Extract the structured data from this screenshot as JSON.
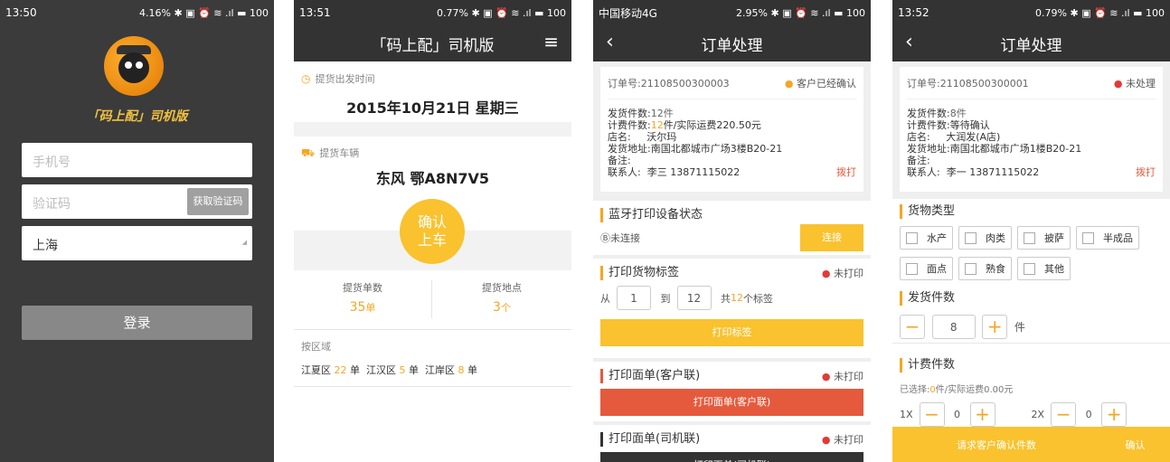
{
  "screen1": {
    "status_time": "13:50",
    "status_right": "4.16% ✱ ▣ ⏰ ≋ .ıl ▬ 100",
    "brand": "「码上配」司机版",
    "phone_placeholder": "手机号",
    "code_placeholder": "验证码",
    "get_code_label": "获取验证码",
    "city_value": "上海",
    "login_label": "登录"
  },
  "screen2": {
    "status_time": "13:51",
    "status_right": "0.77% ✱ ▣ ⏰ ≋ .ıl ▬ 100",
    "title": "「码上配」司机版",
    "pickup_time_label": "提货出发时间",
    "pickup_date": "2015年10月21日 星期三",
    "vehicle_label": "提货车辆",
    "vehicle_name": "东风 鄂A8N7V5",
    "confirm_line1": "确认",
    "confirm_line2": "上车",
    "order_count_label": "提货单数",
    "order_count_value": "35",
    "order_count_unit": "单",
    "location_label": "提货地点",
    "location_value": "3",
    "location_unit": "个",
    "by_area_label": "按区域",
    "areas": [
      {
        "name": "江夏区",
        "count": "22",
        "unit": "单"
      },
      {
        "name": "江汉区",
        "count": "5",
        "unit": "单"
      },
      {
        "name": "江岸区",
        "count": "8",
        "unit": "单"
      }
    ]
  },
  "screen3": {
    "status_carrier": "中国移动4G",
    "status_right": "2.95% ✱ ▣ ⏰ ≋ .ıl ▬ 100",
    "title": "订单处理",
    "order_no": "订单号:21108500300003",
    "order_status": "客户已经确认",
    "ship_count_label": "发货件数:",
    "ship_count_value": "12件",
    "charge_label": "计费件数:",
    "charge_value_highlight": "12",
    "charge_value_rest": "件/实际运费220.50元",
    "store_label": "店名:",
    "store_value": "沃尔玛",
    "address_label": "发货地址:",
    "address_value": "南国北都城市广场3楼B20-21",
    "remark_label": "备注:",
    "contact_label": "联系人:",
    "contact_value": "李三 13871115022",
    "dial_label": "拨打",
    "bt_title": "蓝牙打印设备状态",
    "bt_status": "未连接",
    "connect_label": "连接",
    "label_title": "打印货物标签",
    "not_printed": "未打印",
    "from_label": "从",
    "from_value": "1",
    "to_label": "到",
    "to_value": "12",
    "total_prefix": "共",
    "total_value": "12",
    "total_suffix": "个标签",
    "print_label_btn": "打印标签",
    "customer_title": "打印面单(客户联)",
    "print_customer_btn": "打印面单(客户联)",
    "driver_title": "打印面单(司机联)",
    "print_driver_btn": "打印面单(司机联)"
  },
  "screen4": {
    "status_time": "13:52",
    "status_right": "0.79% ✱ ▣ ⏰ ≋ .ıl ▬ 100",
    "title": "订单处理",
    "order_no": "订单号:21108500300001",
    "order_status": "未处理",
    "ship_count_label": "发货件数:",
    "ship_count_value": "8件",
    "charge_label": "计费件数:",
    "charge_value": "等待确认",
    "store_label": "店名:",
    "store_value": "大润发(A店)",
    "address_label": "发货地址:",
    "address_value": "南国北都城市广场1楼B20-21",
    "remark_label": "备注:",
    "contact_label": "联系人:",
    "contact_value": "李一 13871115022",
    "dial_label": "拨打",
    "goods_type_title": "货物类型",
    "goods_types": [
      "水产",
      "肉类",
      "披萨",
      "半成品",
      "面点",
      "熟食",
      "其他"
    ],
    "ship_count_title": "发货件数",
    "ship_count_input": "8",
    "piece_unit": "件",
    "charge_title": "计费件数",
    "selected_prefix": "已选择:",
    "selected_value": "0",
    "selected_rest": "件/实际运费0.00元",
    "row_a_label": "1X",
    "row_a_value": "0",
    "row_b_label": "2X",
    "row_b_value": "0",
    "request_confirm_label": "请求客户确认件数",
    "confirm_label": "确认"
  },
  "colors": {
    "accent_yellow": "#f9c22e",
    "accent_orange": "#f5a623",
    "red_button": "#e55a3c",
    "nav_dark": "#333333"
  }
}
